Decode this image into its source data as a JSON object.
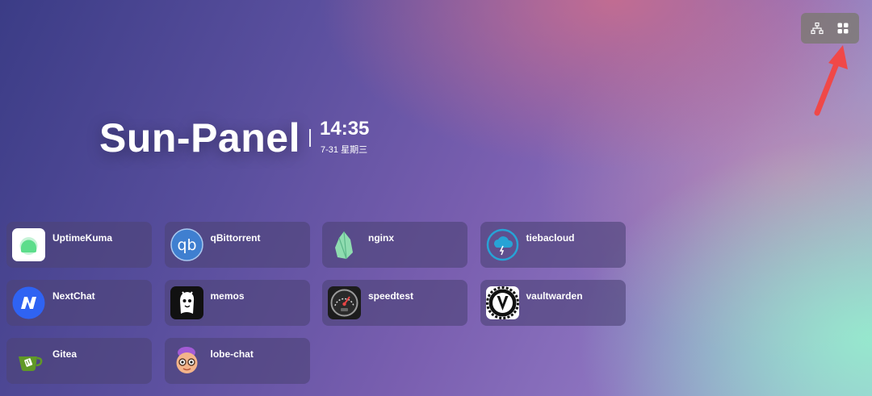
{
  "header": {
    "brand": "Sun-Panel",
    "time": "14:35",
    "date": "7-31 星期三"
  },
  "toolbar": {
    "icons": [
      "sitemap-icon",
      "grid-icon"
    ]
  },
  "annotation": {
    "color": "#f04848"
  },
  "apps": [
    {
      "label": "UptimeKuma",
      "icon": "uptime-kuma-icon"
    },
    {
      "label": "qBittorrent",
      "icon": "qbittorrent-icon"
    },
    {
      "label": "nginx",
      "icon": "nginx-icon"
    },
    {
      "label": "tiebacloud",
      "icon": "tiebacloud-icon"
    },
    {
      "label": "NextChat",
      "icon": "nextchat-icon"
    },
    {
      "label": "memos",
      "icon": "memos-icon"
    },
    {
      "label": "speedtest",
      "icon": "speedtest-icon"
    },
    {
      "label": "vaultwarden",
      "icon": "vaultwarden-icon"
    },
    {
      "label": "Gitea",
      "icon": "gitea-icon"
    },
    {
      "label": "lobe-chat",
      "icon": "lobe-chat-icon"
    }
  ]
}
